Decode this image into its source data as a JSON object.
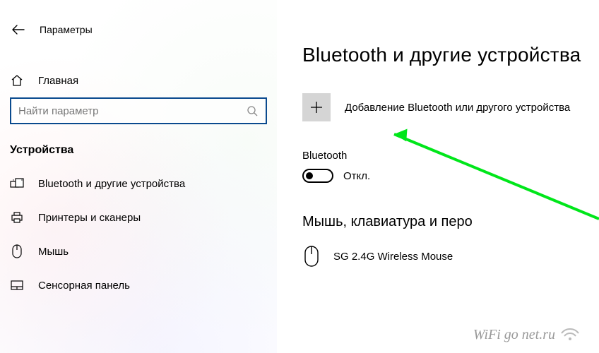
{
  "app": {
    "title": "Параметры"
  },
  "sidebar": {
    "home_label": "Главная",
    "search_placeholder": "Найти параметр",
    "section_header": "Устройства",
    "items": [
      {
        "label": "Bluetooth и другие устройства"
      },
      {
        "label": "Принтеры и сканеры"
      },
      {
        "label": "Мышь"
      },
      {
        "label": "Сенсорная панель"
      }
    ]
  },
  "main": {
    "title": "Bluetooth и другие устройства",
    "add_device_label": "Добавление Bluetooth или другого устройства",
    "bluetooth_label": "Bluetooth",
    "toggle_state": "Откл.",
    "sub_header": "Мышь, клавиатура и перо",
    "device_name": "SG 2.4G Wireless Mouse"
  },
  "watermark": "WiFi go net.ru"
}
